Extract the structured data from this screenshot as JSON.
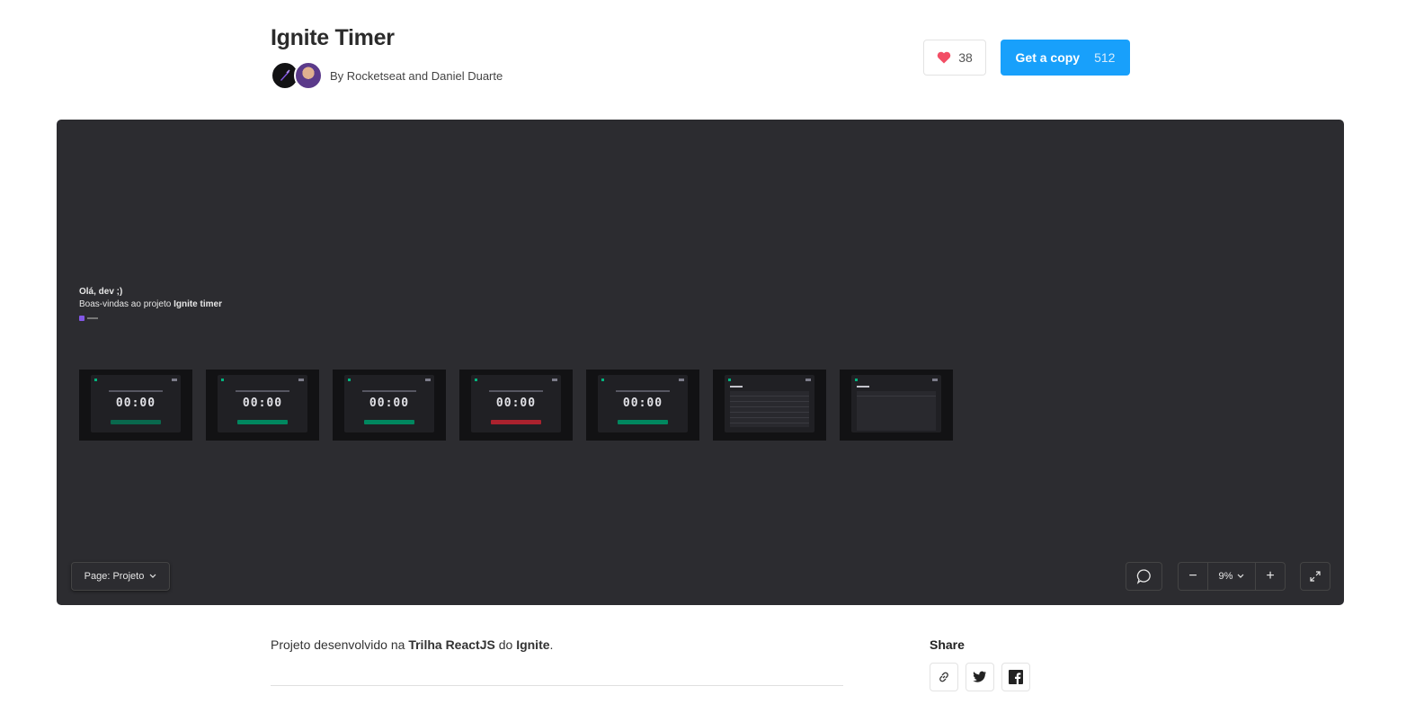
{
  "header": {
    "title": "Ignite Timer",
    "byline": "By Rocketseat and Daniel Duarte",
    "likes": "38",
    "copy_label": "Get a copy",
    "copy_count": "512"
  },
  "canvas": {
    "intro_hello": "Olá, dev ;)",
    "intro_welcome_prefix": "Boas-vindas ao projeto ",
    "intro_welcome_bold": "Ignite timer",
    "timer_value": "00:00",
    "page_label": "Page: Projeto",
    "zoom": "9%"
  },
  "colors": {
    "accent": "#18a0fb",
    "canvas_bg": "#2c2c30",
    "green": "#00875f",
    "red": "#ab222e"
  },
  "footer": {
    "desc_prefix": "Projeto desenvolvido na ",
    "desc_bold1": "Trilha ReactJS",
    "desc_mid": " do ",
    "desc_bold2": "Ignite",
    "desc_suffix": ".",
    "share_title": "Share"
  },
  "icons": [
    "heart-icon",
    "chevron-down-icon",
    "comment-icon",
    "minus-icon",
    "plus-icon",
    "expand-icon",
    "link-icon",
    "twitter-icon",
    "facebook-icon"
  ]
}
